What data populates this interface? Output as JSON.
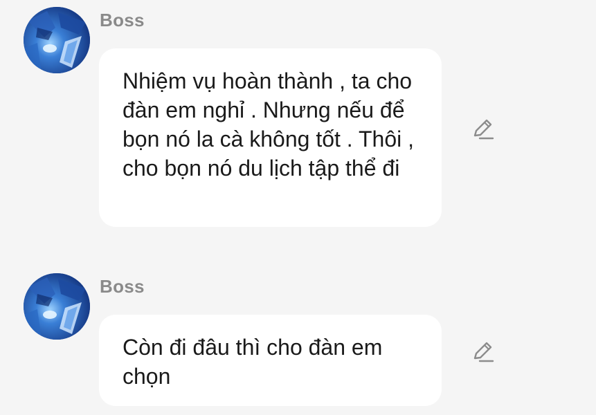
{
  "messages": [
    {
      "sender": "Boss",
      "avatar_icon": "armored-knight-avatar",
      "text": "Nhiệm vụ hoàn thành , ta cho đàn em nghỉ . Nhưng nếu để bọn nó la cà không tốt . Thôi , cho bọn nó du lịch tập thể đi",
      "action_icon": "edit-pencil-icon"
    },
    {
      "sender": "Boss",
      "avatar_icon": "armored-knight-avatar",
      "text": "Còn đi đâu thì cho đàn em chọn",
      "action_icon": "edit-pencil-icon"
    }
  ],
  "colors": {
    "background": "#f5f5f5",
    "bubble": "#ffffff",
    "sender_name": "#8a8a8a",
    "message_text": "#1a1a1a",
    "avatar_blue": "#1f4fa8"
  }
}
